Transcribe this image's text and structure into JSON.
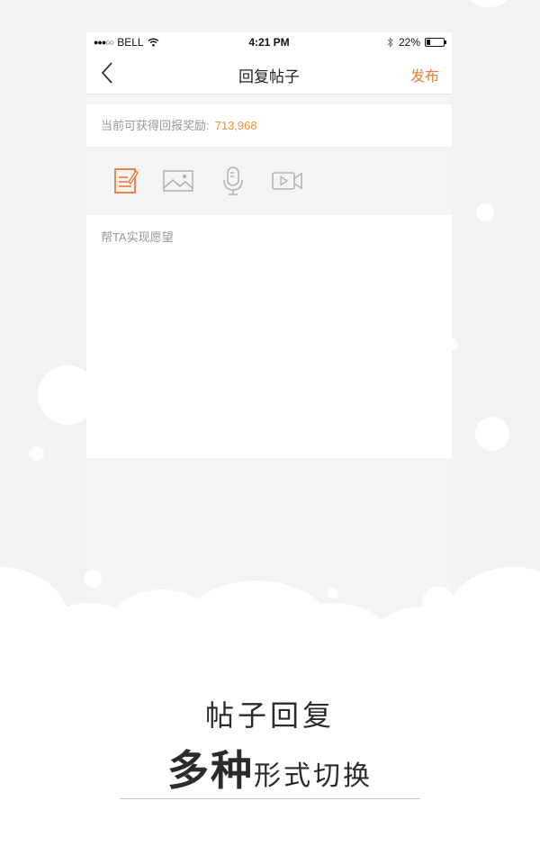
{
  "status_bar": {
    "carrier": "BELL",
    "time": "4:21 PM",
    "battery": "22%",
    "battery_level": 0.22
  },
  "nav": {
    "title": "回复帖子",
    "publish_label": "发布"
  },
  "reward": {
    "label": "当前可获得回报奖励:",
    "value": "713,968"
  },
  "toolbar": {
    "tools": [
      "text-edit-icon",
      "image-icon",
      "microphone-icon",
      "video-icon"
    ],
    "active_tool": "text-edit-icon"
  },
  "editor": {
    "placeholder": "帮TA实现愿望"
  },
  "caption": {
    "line1": "帖子回复",
    "line2_bold": "多种",
    "line2_rest": "形式切换"
  },
  "colors": {
    "accent": "#f07a37",
    "reward_value": "#f0933a",
    "background": "#f2f2f3"
  }
}
